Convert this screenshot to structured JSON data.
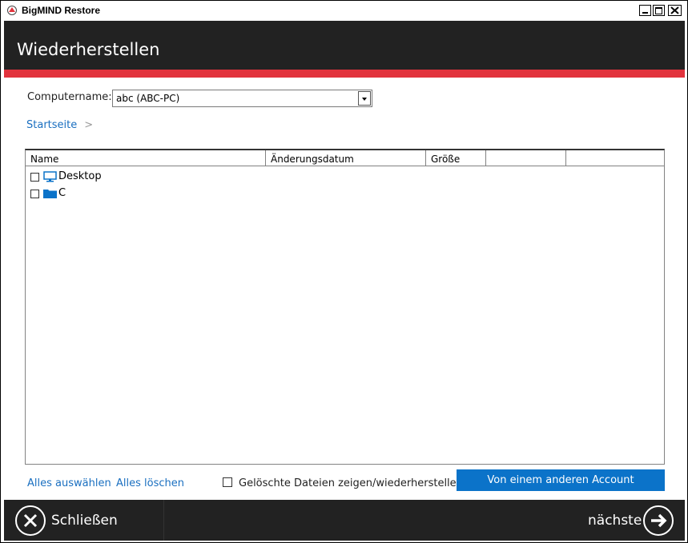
{
  "window": {
    "title": "BigMIND Restore"
  },
  "header": {
    "title": "Wiederherstellen"
  },
  "computer": {
    "label": "Computername:",
    "selected": "abc (ABC-PC)"
  },
  "breadcrumb": {
    "home": "Startseite",
    "separator": ">"
  },
  "table": {
    "columns": [
      "Name",
      "Änderungsdatum",
      "Größe",
      "",
      ""
    ],
    "rows": [
      {
        "label": "Desktop",
        "icon": "monitor-icon",
        "checked": false
      },
      {
        "label": "C",
        "icon": "folder-icon",
        "checked": false
      }
    ]
  },
  "actions": {
    "select_all": "Alles auswählen",
    "clear_all": "Alles löschen",
    "show_deleted": "Gelöschte Dateien zeigen/wiederherstellen",
    "other_account": "Von einem anderen Account"
  },
  "footer": {
    "close": "Schließen",
    "next": "nächste"
  },
  "colors": {
    "header_bg": "#222222",
    "accent_red": "#e2333d",
    "link_blue": "#1a6fc0",
    "button_blue": "#0b73c9",
    "folder_blue": "#0b73c9"
  }
}
